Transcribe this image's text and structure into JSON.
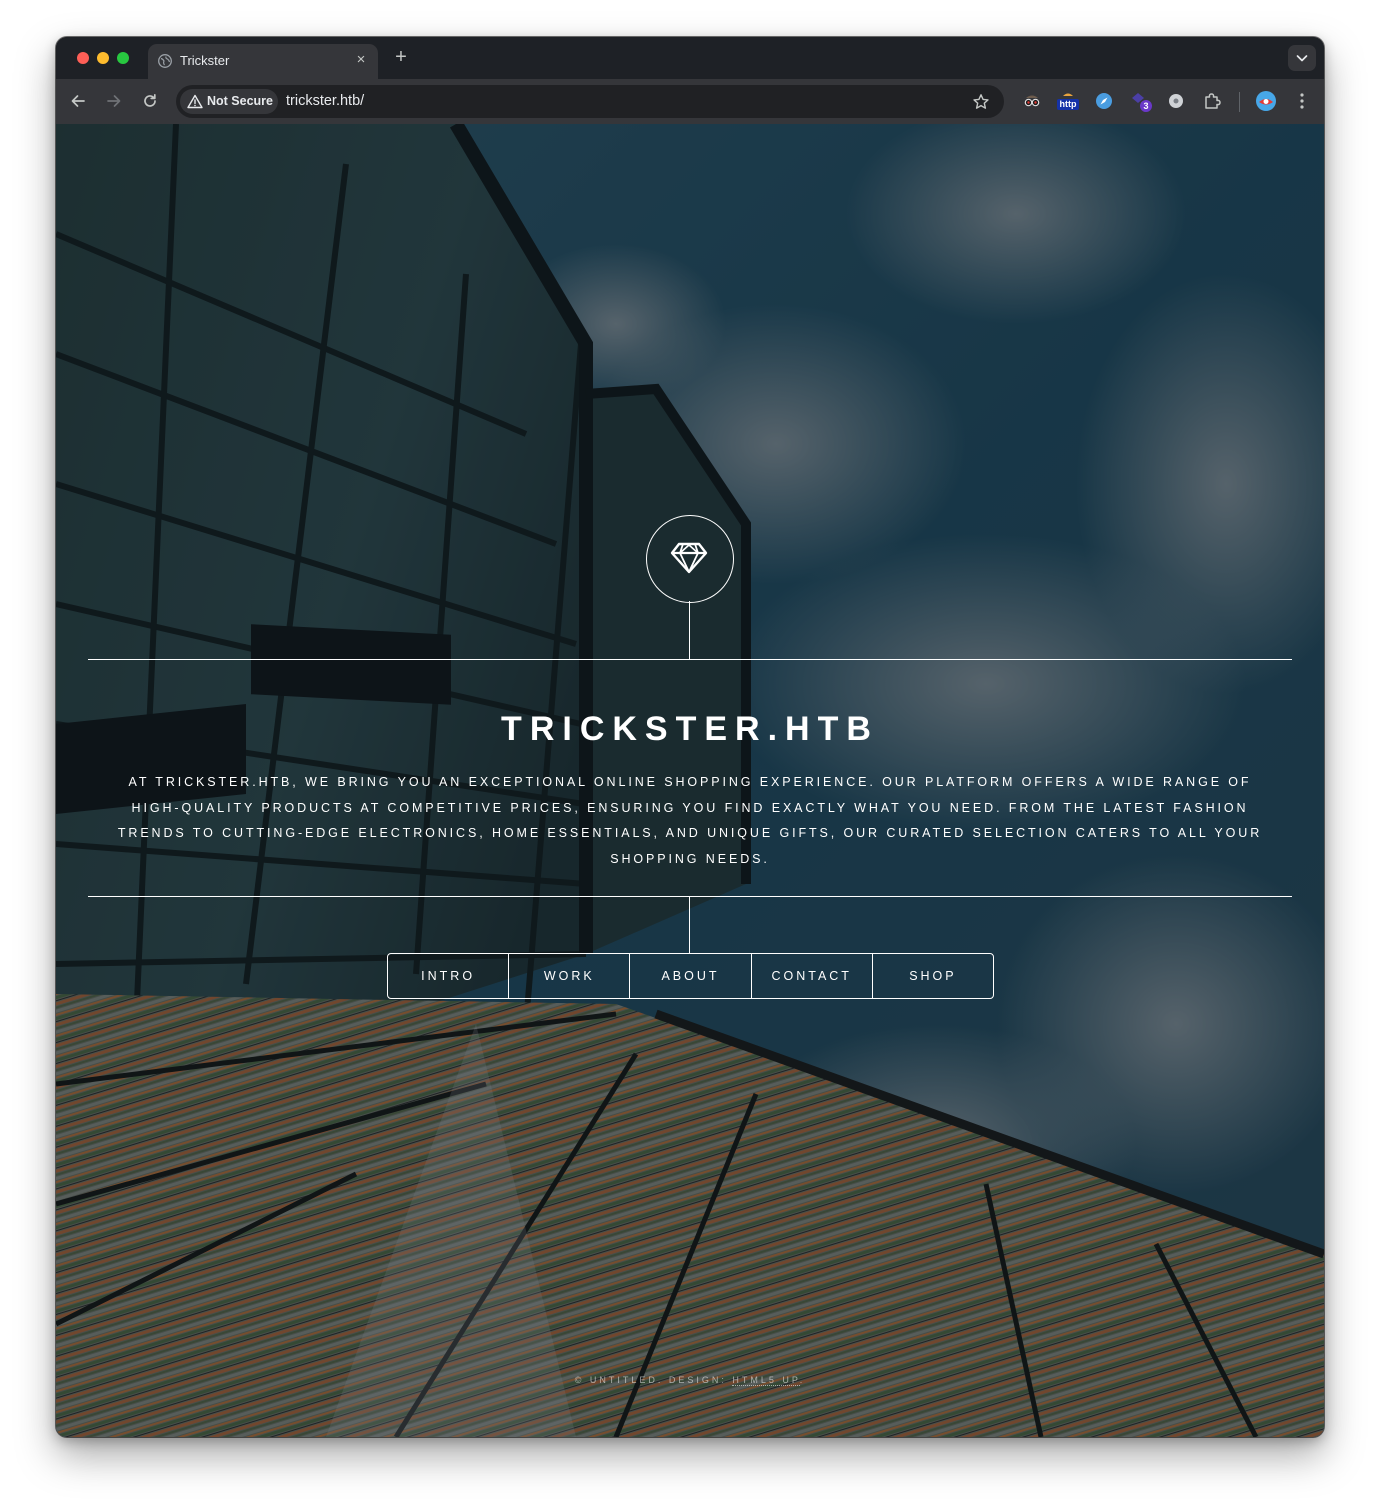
{
  "browser": {
    "tab_title": "Trickster",
    "tab_close": "×",
    "new_tab": "+",
    "security_chip": "Not Secure",
    "url": "trickster.htb/",
    "extension_badge": "3",
    "http_badge": "http"
  },
  "page": {
    "title": "TRICKSTER.HTB",
    "description": "AT TRICKSTER.HTB, WE BRING YOU AN EXCEPTIONAL ONLINE SHOPPING EXPERIENCE. OUR PLATFORM OFFERS A WIDE RANGE OF HIGH-QUALITY PRODUCTS AT COMPETITIVE PRICES, ENSURING YOU FIND EXACTLY WHAT YOU NEED. FROM THE LATEST FASHION TRENDS TO CUTTING-EDGE ELECTRONICS, HOME ESSENTIALS, AND UNIQUE GIFTS, OUR CURATED SELECTION CATERS TO ALL YOUR SHOPPING NEEDS.",
    "nav": [
      {
        "label": "INTRO"
      },
      {
        "label": "WORK"
      },
      {
        "label": "ABOUT"
      },
      {
        "label": "CONTACT"
      },
      {
        "label": "SHOP"
      }
    ],
    "footer": {
      "prefix": "© UNTITLED. DESIGN: ",
      "link": "HTML5 UP",
      "suffix": "."
    }
  },
  "icons": {
    "logo": "diamond-icon",
    "security": "warning-triangle-icon",
    "favicon": "globe-icon"
  },
  "colors": {
    "window_chrome": "#1e2126",
    "toolbar": "#35363a",
    "omnibox": "#202124",
    "page_text": "#ffffff"
  }
}
